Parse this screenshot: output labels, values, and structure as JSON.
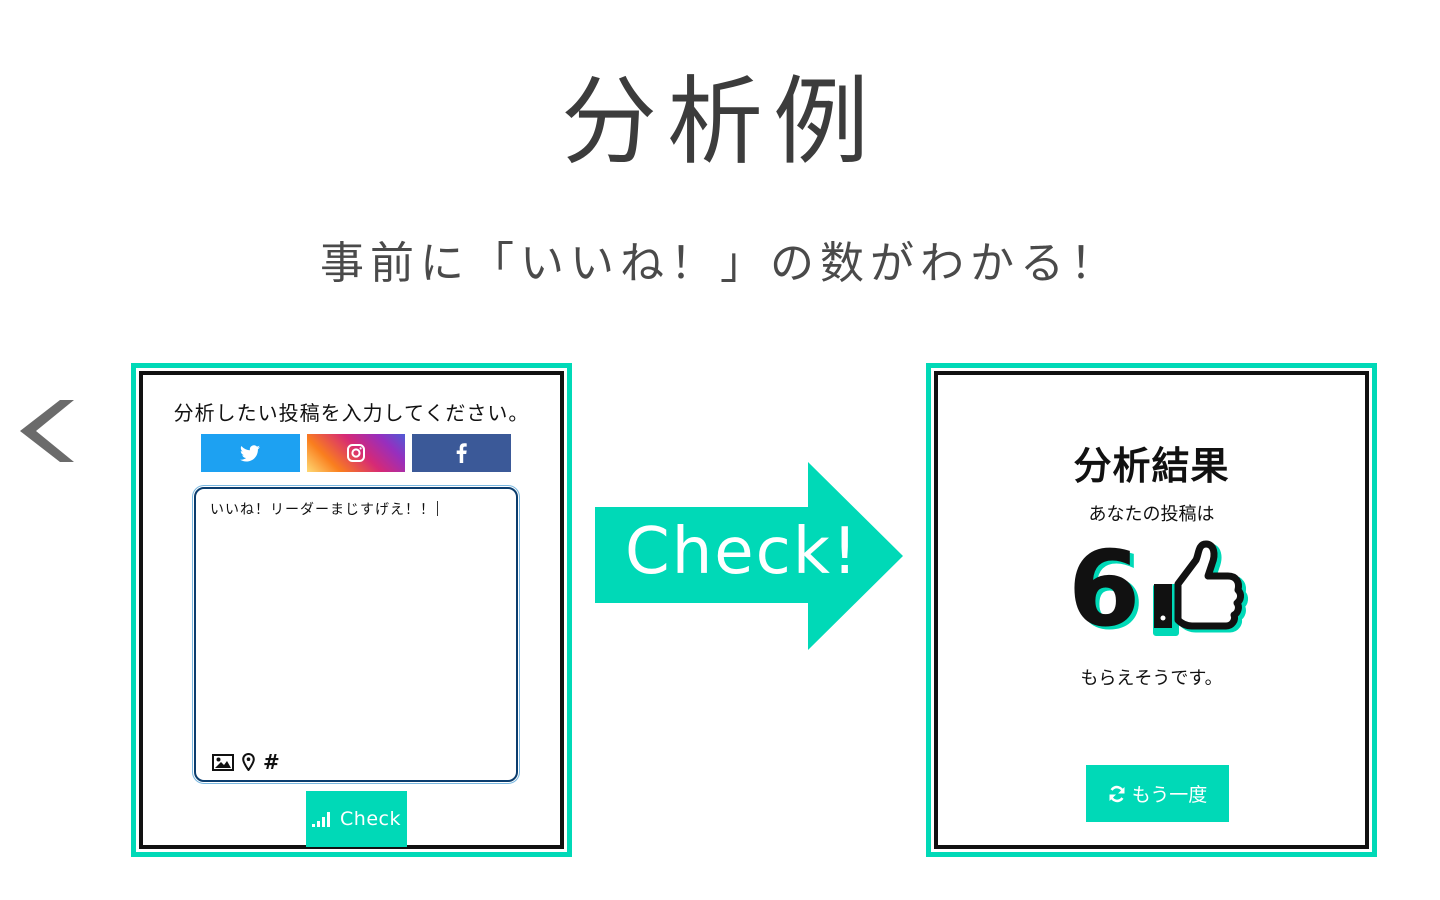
{
  "page": {
    "title": "分析例",
    "subtitle": "事前に「いいね！」の数がわかる！"
  },
  "nav": {
    "back_icon": "chevron-left-icon"
  },
  "input_panel": {
    "prompt": "分析したい投稿を入力してください。",
    "sns_buttons": [
      {
        "name": "twitter",
        "icon": "twitter-icon",
        "color": "#1da1f2"
      },
      {
        "name": "instagram",
        "icon": "instagram-icon",
        "color": "#d62976"
      },
      {
        "name": "facebook",
        "icon": "facebook-icon",
        "color": "#3b5998"
      }
    ],
    "post_text": "いいね！リーダーまじすげえ！！",
    "tools": [
      "image-icon",
      "location-icon",
      "hashtag-icon"
    ],
    "hashtag_symbol": "#",
    "check_button_label": "Check"
  },
  "arrow": {
    "label": "Check!"
  },
  "result_panel": {
    "title": "分析結果",
    "line1": "あなたの投稿は",
    "count": "6",
    "line2": "もらえそうです。",
    "retry_button_label": "もう一度"
  },
  "colors": {
    "accent": "#00d9b7",
    "border": "#111111",
    "heading": "#3c3c3c"
  }
}
